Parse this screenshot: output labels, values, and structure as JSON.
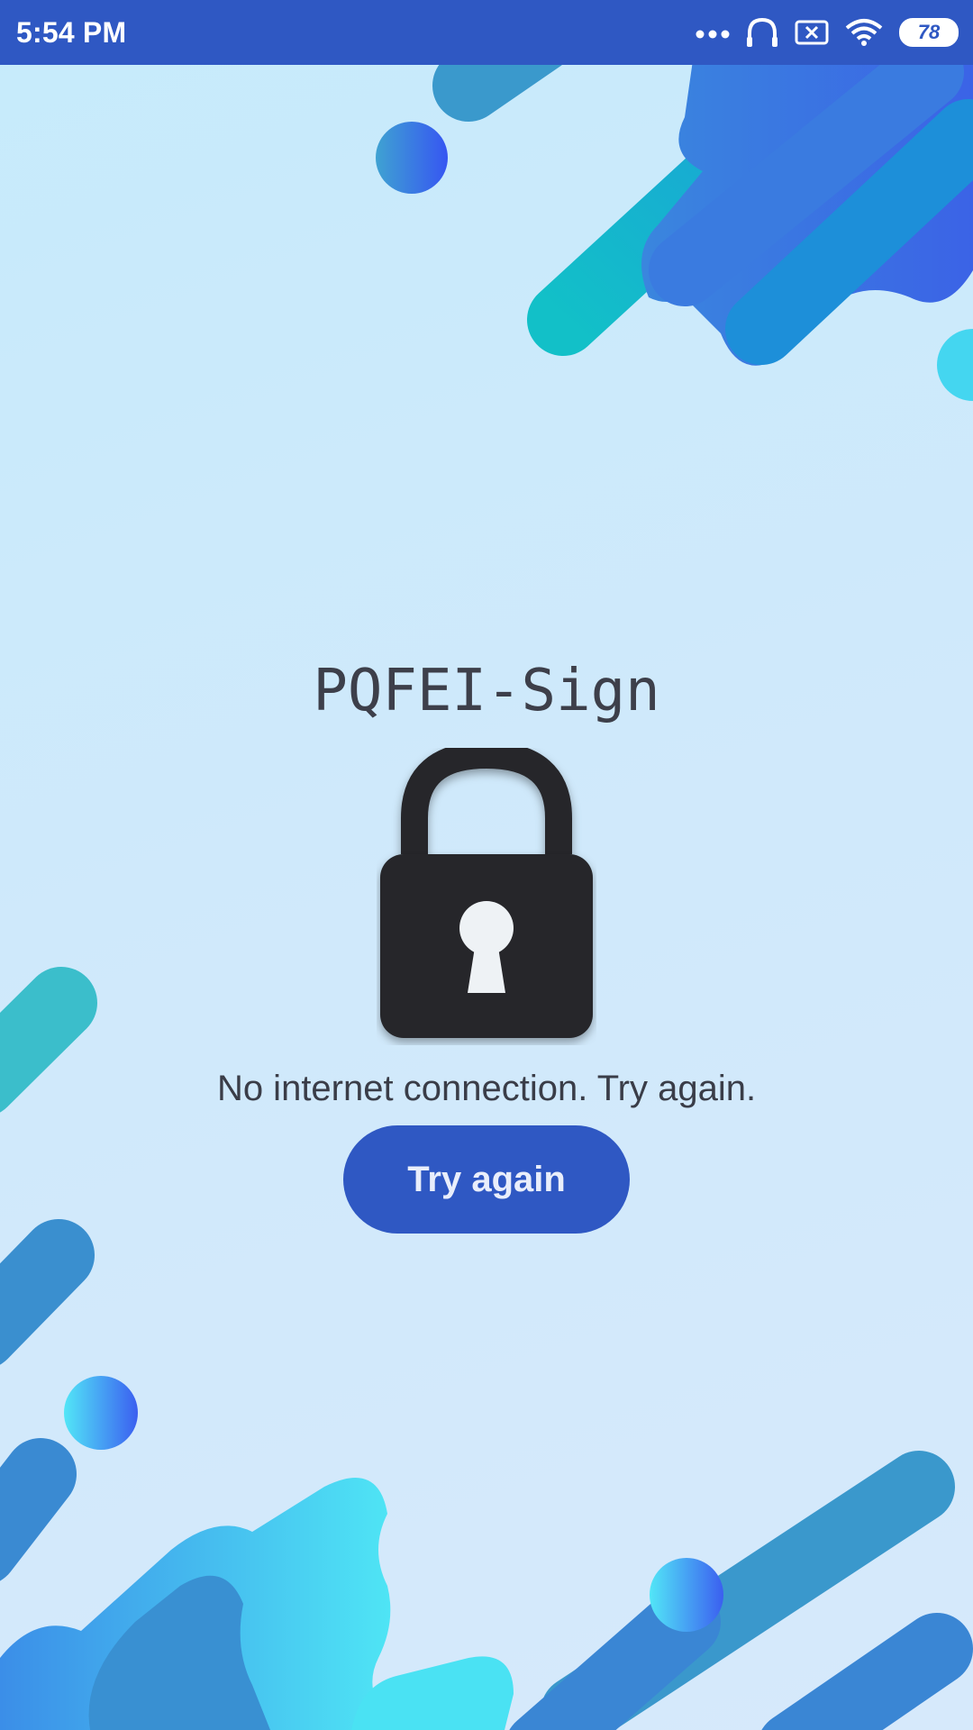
{
  "status_bar": {
    "time": "5:54 PM",
    "battery_level": "78",
    "icons": [
      "more-dots-icon",
      "headphones-icon",
      "no-sim-icon",
      "wifi-icon",
      "battery-icon"
    ]
  },
  "main": {
    "app_title": "PQFEI-Sign",
    "lock_icon": "padlock-icon",
    "message": "No internet connection. Try again.",
    "try_again_label": "Try again"
  },
  "colors": {
    "status_bar": "#2f58c3",
    "button": "#2f58c3",
    "background_top": "#c6ebfb",
    "background_bottom": "#d6e9fb",
    "lock": "#26272b",
    "text": "#3a3d48"
  }
}
